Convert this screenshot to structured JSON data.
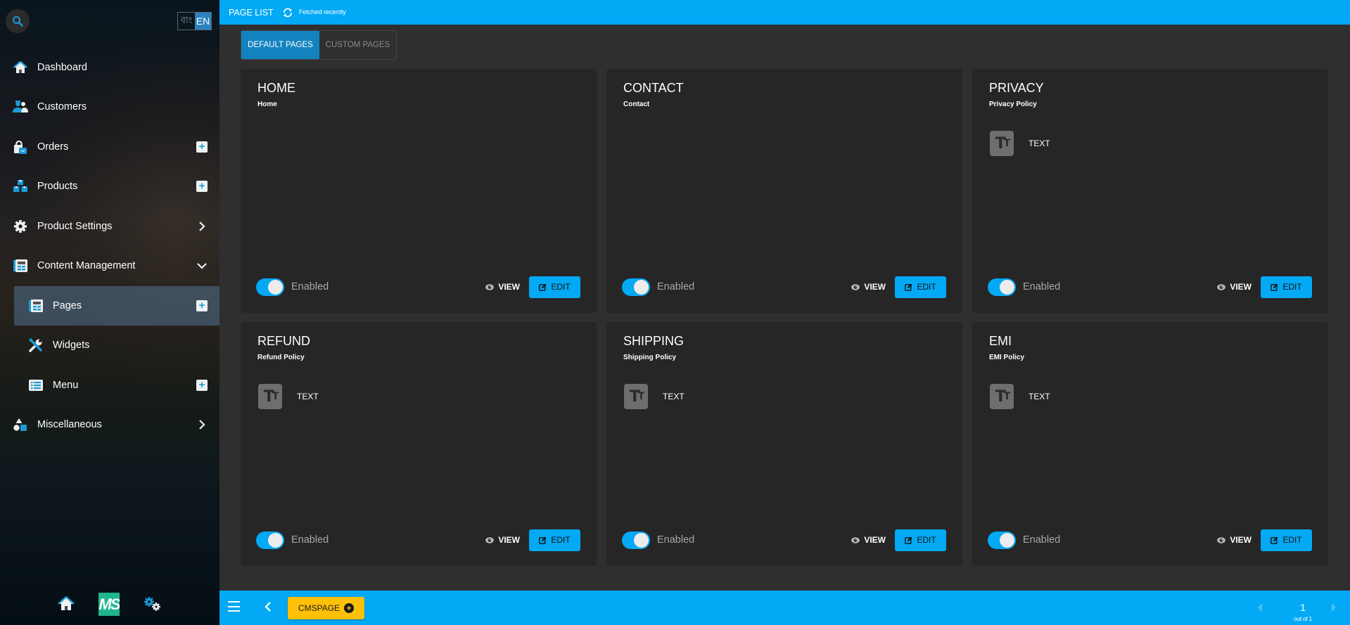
{
  "sidebar": {
    "search_icon": "search-icon",
    "language": {
      "bn": "বাং",
      "en": "EN",
      "active": "EN"
    },
    "items": [
      {
        "label": "Dashboard",
        "icon": "home-icon",
        "action": "none"
      },
      {
        "label": "Customers",
        "icon": "users-icon",
        "action": "none"
      },
      {
        "label": "Orders",
        "icon": "shopping-bag-icon",
        "action": "add"
      },
      {
        "label": "Products",
        "icon": "boxes-icon",
        "action": "add"
      },
      {
        "label": "Product Settings",
        "icon": "gear-icon",
        "action": "expand"
      },
      {
        "label": "Content Management",
        "icon": "layout-icon",
        "action": "collapse"
      },
      {
        "label": "Pages",
        "icon": "layout-icon",
        "action": "add",
        "active": true,
        "sub": true
      },
      {
        "label": "Widgets",
        "icon": "tools-icon",
        "action": "none",
        "sub": true
      },
      {
        "label": "Menu",
        "icon": "list-icon",
        "action": "add",
        "sub": true
      },
      {
        "label": "Miscellaneous",
        "icon": "shapes-icon",
        "action": "expand"
      }
    ],
    "bottom": {
      "logo_text": "MS",
      "home_icon": "home-icon",
      "settings_icon": "gears-icon"
    }
  },
  "topbar": {
    "title": "PAGE LIST",
    "refresh_icon": "refresh-icon",
    "status": "Fetched recently",
    "accent_color": "#03a9f4"
  },
  "tabs": [
    {
      "label": "DEFAULT PAGES",
      "active": true
    },
    {
      "label": "CUSTOM PAGES",
      "active": false
    }
  ],
  "pages": [
    {
      "title": "HOME",
      "subtitle": "Home",
      "widgets": [],
      "status": "Enabled",
      "enabled": true,
      "view_label": "VIEW",
      "edit_label": "EDIT"
    },
    {
      "title": "CONTACT",
      "subtitle": "Contact",
      "widgets": [],
      "status": "Enabled",
      "enabled": true,
      "view_label": "VIEW",
      "edit_label": "EDIT"
    },
    {
      "title": "PRIVACY",
      "subtitle": "Privacy Policy",
      "widgets": [
        {
          "icon": "text-icon",
          "label": "TEXT"
        }
      ],
      "status": "Enabled",
      "enabled": true,
      "view_label": "VIEW",
      "edit_label": "EDIT"
    },
    {
      "title": "REFUND",
      "subtitle": "Refund Policy",
      "widgets": [
        {
          "icon": "text-icon",
          "label": "TEXT"
        }
      ],
      "status": "Enabled",
      "enabled": true,
      "view_label": "VIEW",
      "edit_label": "EDIT"
    },
    {
      "title": "SHIPPING",
      "subtitle": "Shipping Policy",
      "widgets": [
        {
          "icon": "text-icon",
          "label": "TEXT"
        }
      ],
      "status": "Enabled",
      "enabled": true,
      "view_label": "VIEW",
      "edit_label": "EDIT"
    },
    {
      "title": "EMI",
      "subtitle": "EMI Policy",
      "widgets": [
        {
          "icon": "text-icon",
          "label": "TEXT"
        }
      ],
      "status": "Enabled",
      "enabled": true,
      "view_label": "VIEW",
      "edit_label": "EDIT"
    }
  ],
  "bottombar": {
    "menu_icon": "hamburger-icon",
    "back_icon": "chevron-left-icon",
    "cms_button_label": "CMSPAGE",
    "cms_button_color": "#ffc107",
    "pagination": {
      "current": "1",
      "total_label": "out of 1"
    }
  }
}
